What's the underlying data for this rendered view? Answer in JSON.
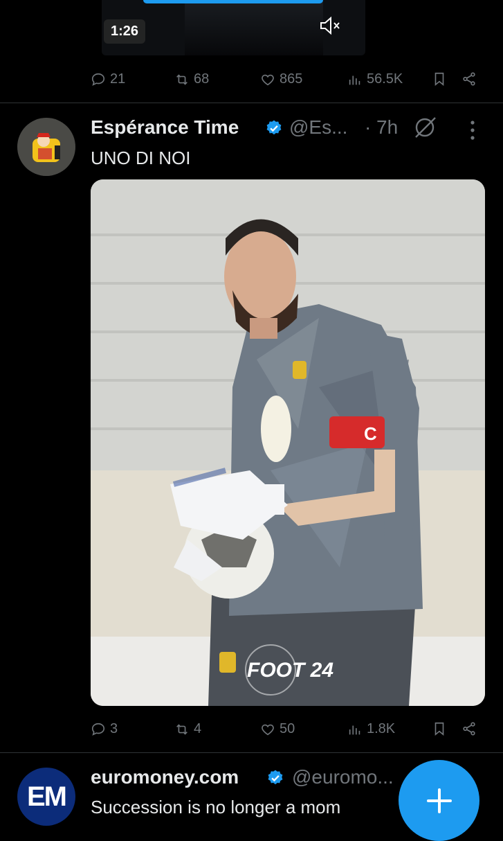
{
  "video": {
    "time": "1:26",
    "mute_icon": "mute-icon"
  },
  "tweet1_actions": {
    "replies": "21",
    "retweets": "68",
    "likes": "865",
    "views": "56.5K"
  },
  "tweet2": {
    "name": "Espérance Time",
    "handle": "@Es...",
    "dot": "·",
    "time": "7h",
    "text": "UNO DI NOI",
    "media_watermark": "FOOT 24",
    "media_captain_letter": "C",
    "replies": "3",
    "retweets": "4",
    "likes": "50",
    "views": "1.8K"
  },
  "tweet3": {
    "name": "euromoney.com",
    "handle": "@euromo...",
    "avatar_text": "EM",
    "text": "Succession is no longer a mom"
  },
  "colors": {
    "accent": "#1d9bf0",
    "muted": "#71767b",
    "background": "#000000"
  }
}
